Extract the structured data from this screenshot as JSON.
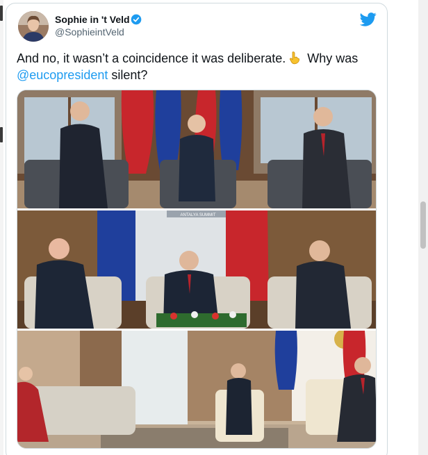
{
  "author": {
    "name": "Sophie in 't Veld",
    "handle": "@SophieintVeld",
    "verified": true
  },
  "tweet": {
    "text_part1": "And no, it wasn’t a coincidence it was deliberate.",
    "text_part2": " Why was ",
    "mention": "@eucopresident",
    "text_part3": " silent?",
    "emoji": "pointing-down-hand-icon"
  },
  "photos": [
    {
      "name": "photo-1",
      "description_icon": "meeting-photo-icon"
    },
    {
      "name": "photo-2",
      "description_icon": "meeting-photo-icon",
      "sign_text": "ANTALYA SUMMIT"
    },
    {
      "name": "photo-3",
      "description_icon": "meeting-photo-icon"
    }
  ],
  "colors": {
    "text": "#0f1419",
    "secondary": "#536471",
    "accent": "#1d9bf0",
    "border": "#cfd9de"
  }
}
